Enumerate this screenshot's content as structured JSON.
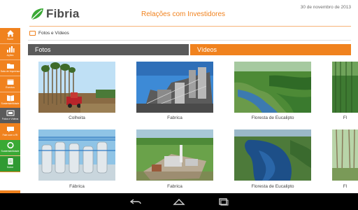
{
  "header": {
    "brand": "Fibria",
    "title": "Relações com Investidores",
    "date": "30 de novembro de 2013"
  },
  "sidebar": {
    "items": [
      {
        "label": "Home",
        "icon": "home-icon"
      },
      {
        "label": "Ações",
        "icon": "bar-chart-icon"
      },
      {
        "label": "Sala de Imprensa",
        "icon": "folder-icon"
      },
      {
        "label": "Eventos",
        "icon": "calendar-icon"
      },
      {
        "label": "Sustentabilidade",
        "icon": "book-icon"
      },
      {
        "label": "Fotos e Vídeos",
        "icon": "photos-icon"
      },
      {
        "label": "Fale com o RI",
        "icon": "chat-icon"
      },
      {
        "label": "Sustentabilidade",
        "icon": "recycle-icon"
      },
      {
        "label": "Sobre",
        "icon": "document-icon"
      }
    ]
  },
  "breadcrumb": {
    "label": "Fotos e Vídeos"
  },
  "tabs": {
    "photos": "Fotos",
    "videos": "Vídeos"
  },
  "gallery": {
    "items": [
      {
        "caption": "Colheita"
      },
      {
        "caption": "Fabrica"
      },
      {
        "caption": "Floresta de Eucalipto"
      },
      {
        "caption": "Fl"
      },
      {
        "caption": "Fábrica"
      },
      {
        "caption": "Fabrica"
      },
      {
        "caption": "Floresta de Eucalipto"
      },
      {
        "caption": "Fl"
      }
    ]
  },
  "colors": {
    "accent": "#f0821e",
    "dark": "#5a5a5a",
    "green": "#3aa935"
  }
}
